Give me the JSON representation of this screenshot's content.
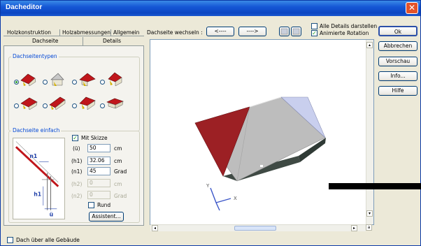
{
  "window": {
    "title": "Dacheditor",
    "close_glyph": "✕"
  },
  "tabs": {
    "row1": [
      "Holzkonstruktion",
      "Holzabmessungen",
      "Allgemein"
    ],
    "row2": [
      "Dachseite",
      "Details"
    ],
    "active": "Dachseite"
  },
  "toolbar": {
    "switch_label": "Dachseite wechseln :",
    "prev_label": "<----",
    "next_label": "---->",
    "show_all_details": "Alle Details darstellen",
    "show_all_details_checked": false,
    "animate_rotation": "Animierte Rotation",
    "animate_rotation_checked": true
  },
  "roof_types": {
    "title": "Dachseitentypen",
    "selected_index": 0,
    "count": 8
  },
  "roof_side": {
    "title": "Dachseite einfach",
    "sketch_checkbox": "Mit Skizze",
    "sketch_checked": true,
    "params": [
      {
        "symbol": "(ü)",
        "value": "50",
        "unit": "cm",
        "enabled": true
      },
      {
        "symbol": "(h1)",
        "value": "32.06",
        "unit": "cm",
        "enabled": true
      },
      {
        "symbol": "(n1)",
        "value": "45",
        "unit": "Grad",
        "enabled": true
      },
      {
        "symbol": "(h2)",
        "value": "0",
        "unit": "cm",
        "enabled": false
      },
      {
        "symbol": "(n2)",
        "value": "0",
        "unit": "Grad",
        "enabled": false
      }
    ],
    "round_label": "Rund",
    "round_checked": false,
    "assistant_button": "Assistent...",
    "sketch_labels": {
      "n1": "n1",
      "h1": "h1",
      "u": "ü"
    }
  },
  "right_buttons": {
    "ok": "Ok",
    "cancel": "Abbrechen",
    "preview": "Vorschau",
    "info": "Info...",
    "help": "Hilfe"
  },
  "viewport": {
    "axis_y": "Y",
    "axis_x": "X",
    "colors": {
      "roof_gray": "#bdbdbd",
      "roof_red": "#9c2024",
      "roof_blue": "#c9cfee",
      "wall_dark": "#3f4a44",
      "axis_blue": "#3b56c8"
    }
  },
  "footer": {
    "all_buildings": "Dach über alle Gebäude",
    "all_buildings_checked": false
  }
}
